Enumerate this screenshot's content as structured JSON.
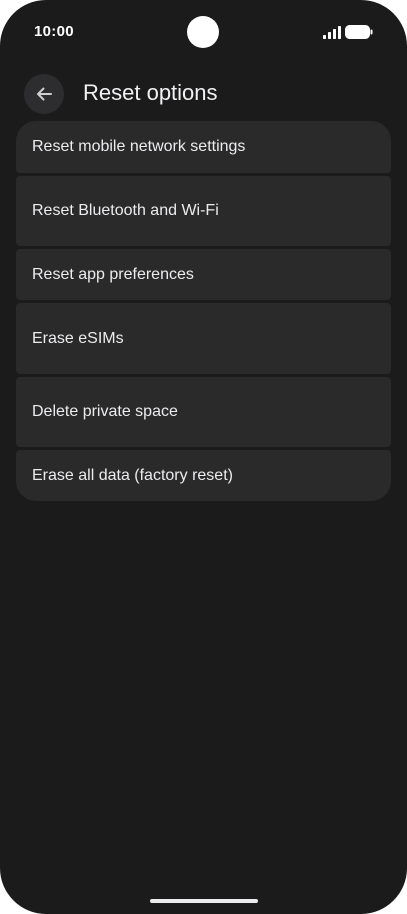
{
  "status_bar": {
    "time": "10:00",
    "icons": [
      "signal-icon",
      "battery-icon"
    ]
  },
  "header": {
    "back_icon": "arrow-left-icon",
    "title": "Reset options"
  },
  "options": [
    {
      "label": "Reset mobile network settings"
    },
    {
      "label": "Reset Bluetooth and Wi-Fi"
    },
    {
      "label": "Reset app preferences"
    },
    {
      "label": "Erase eSIMs"
    },
    {
      "label": "Delete private space"
    },
    {
      "label": "Erase all data (factory reset)"
    }
  ],
  "colors": {
    "background": "#1b1b1c",
    "card": "#2a2a2b",
    "text": "#ececee"
  }
}
